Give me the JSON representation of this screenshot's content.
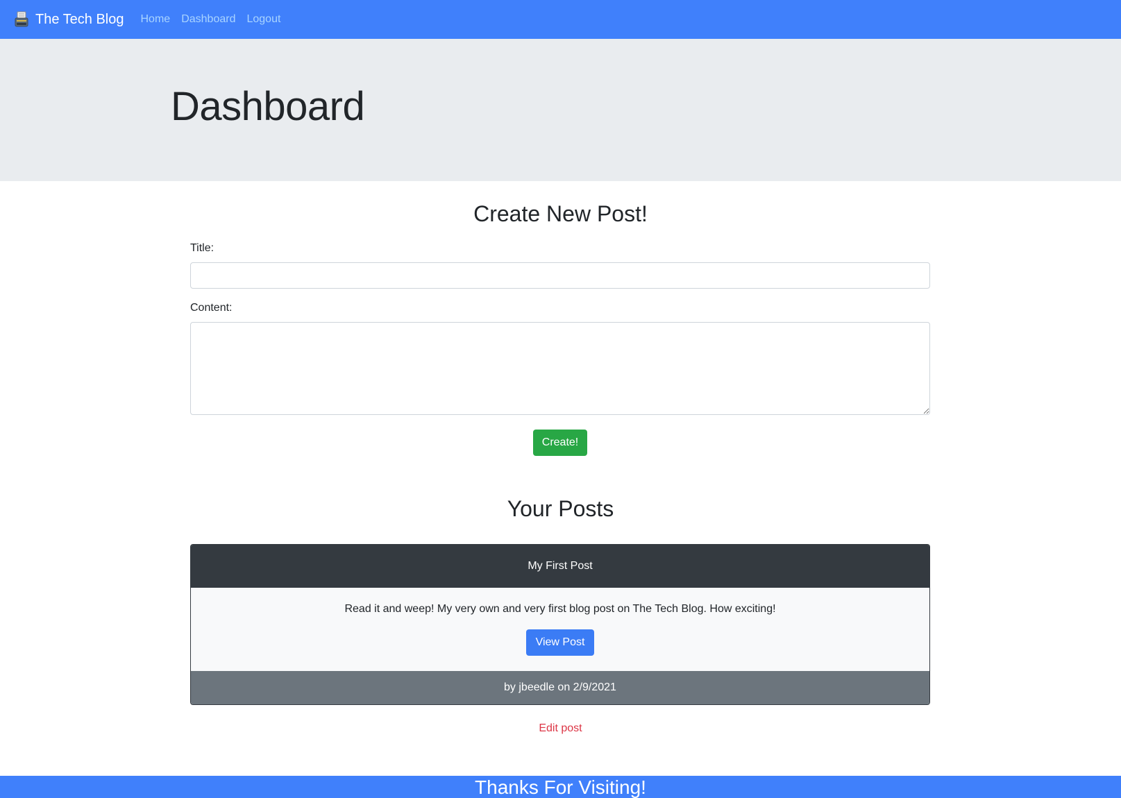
{
  "navbar": {
    "brand_icon": "typewriter-icon",
    "brand": "The Tech Blog",
    "links": [
      {
        "label": "Home"
      },
      {
        "label": "Dashboard"
      },
      {
        "label": "Logout"
      }
    ]
  },
  "hero": {
    "title": "Dashboard"
  },
  "create_post": {
    "heading": "Create New Post!",
    "title_label": "Title:",
    "title_value": "",
    "content_label": "Content:",
    "content_value": "",
    "submit_label": "Create!"
  },
  "your_posts": {
    "heading": "Your Posts",
    "posts": [
      {
        "title": "My First Post",
        "content": "Read it and weep! My very own and very first blog post on The Tech Blog. How exciting!",
        "view_label": "View Post",
        "footer": "by jbeedle on 2/9/2021",
        "edit_label": "Edit post"
      }
    ]
  },
  "footer": {
    "text": "Thanks For Visiting!"
  },
  "colors": {
    "navbar": "#4080fb",
    "hero": "#e9ecef",
    "success": "#28a745",
    "primary": "#3b7cf5",
    "card_header": "#343a40",
    "card_footer": "#6c757d",
    "danger": "#dc3545"
  }
}
